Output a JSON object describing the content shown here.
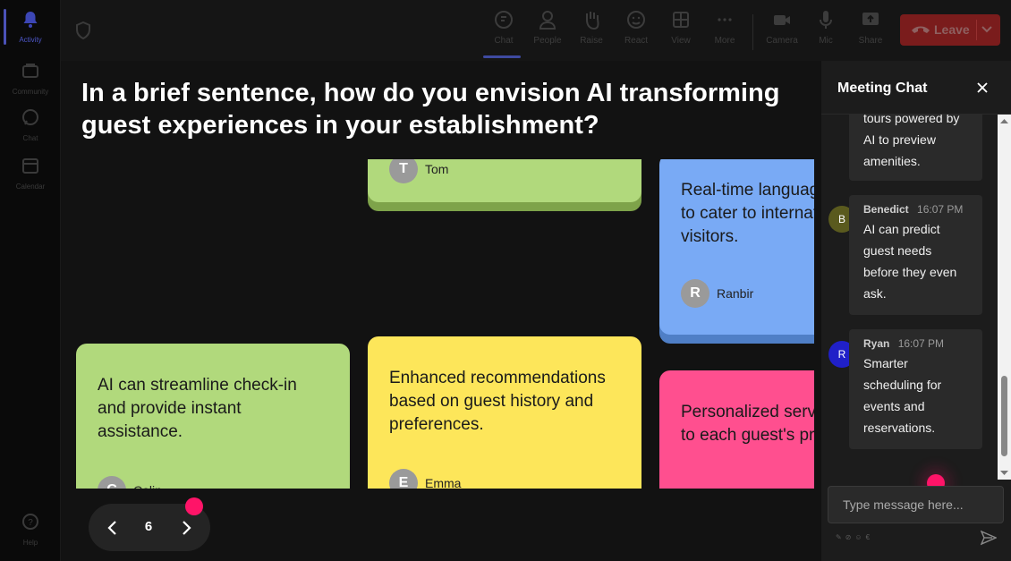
{
  "rail": {
    "items": [
      {
        "label": "Activity",
        "icon": "bell-icon"
      },
      {
        "label": "Community",
        "icon": "community-icon"
      },
      {
        "label": "Chat",
        "icon": "chat-icon"
      },
      {
        "label": "Calendar",
        "icon": "calendar-icon"
      },
      {
        "label": "Help",
        "icon": "help-icon"
      }
    ]
  },
  "toolbar": {
    "chat": "Chat",
    "people": "People",
    "raise": "Raise",
    "react": "React",
    "view": "View",
    "more": "More",
    "camera": "Camera",
    "mic": "Mic",
    "share": "Share",
    "leave": "Leave"
  },
  "question": "In a brief sentence, how do you envision AI transforming guest experiences in your establishment?",
  "notes": [
    {
      "text": "",
      "author": "Tom",
      "initial": "T",
      "color": "#b1d97c"
    },
    {
      "text": "Real-time language translation to cater to international visitors.",
      "author": "Ranbir",
      "initial": "R",
      "color": "#79aaf5"
    },
    {
      "text": "AI can streamline check-in and provide instant assistance.",
      "author": "Colin",
      "initial": "C",
      "color": "#b1d97c"
    },
    {
      "text": "Enhanced recommendations based on guest history and preferences.",
      "author": "Emma",
      "initial": "E",
      "color": "#fde65a"
    },
    {
      "text": "Personalized services tailored to each guest's preferences.",
      "author": "",
      "initial": "",
      "color": "#ff4f8f"
    }
  ],
  "pager": {
    "page": "6"
  },
  "chat": {
    "title": "Meeting Chat",
    "messages": [
      {
        "text": "tours powered by AI to preview amenities."
      },
      {
        "name": "Benedict",
        "time": "16:07 PM",
        "initial": "B",
        "color": "#5a5a1e",
        "text": "AI can predict guest needs before they even ask."
      },
      {
        "name": "Ryan",
        "time": "16:07 PM",
        "initial": "R",
        "color": "#2020c8",
        "text": "Smarter scheduling for events and reservations."
      }
    ],
    "placeholder": "Type message here..."
  }
}
